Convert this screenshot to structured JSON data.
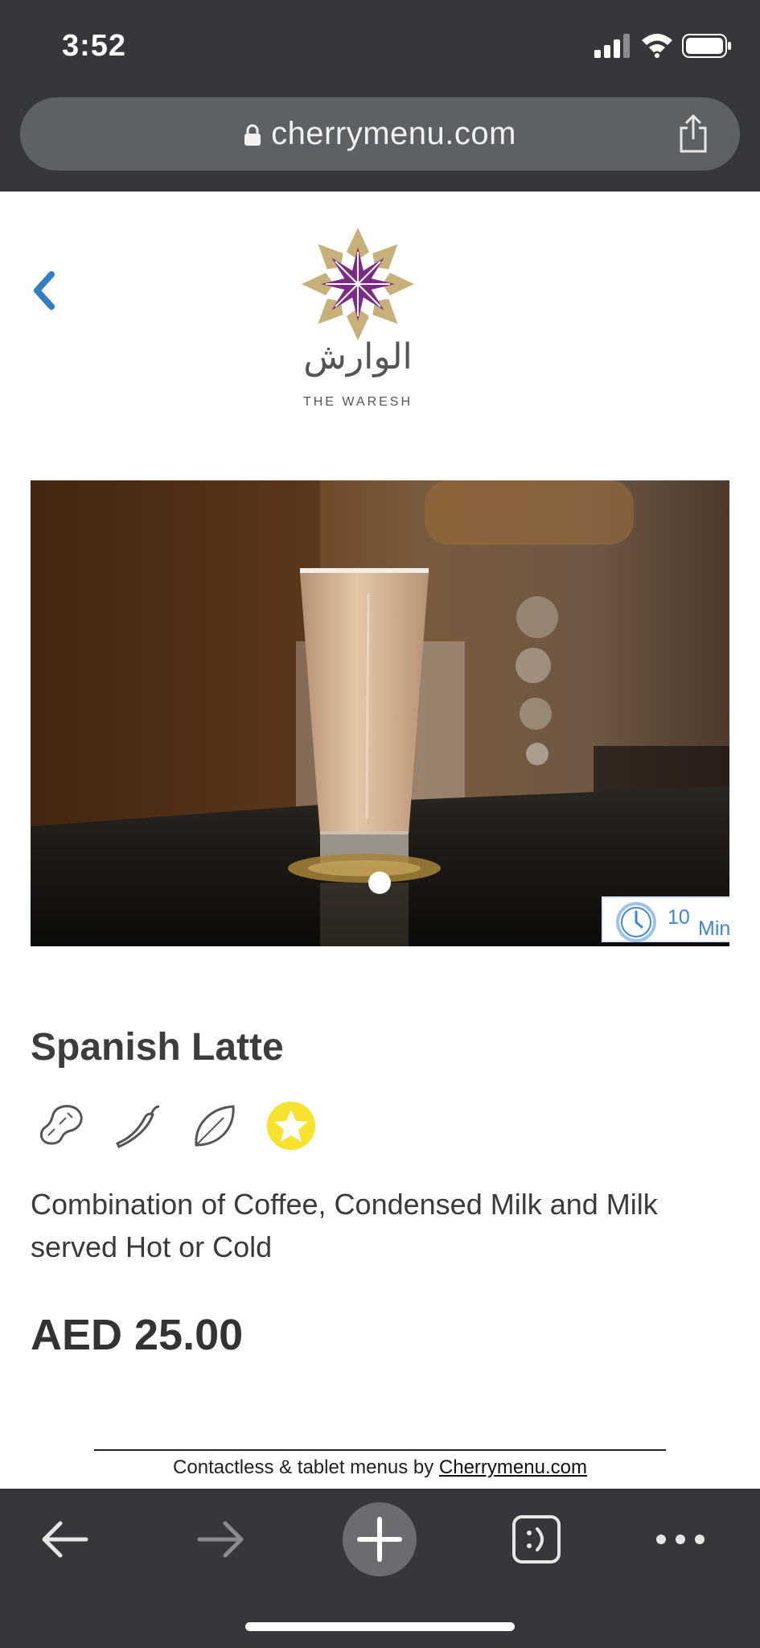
{
  "status_bar": {
    "time": "3:52"
  },
  "browser": {
    "url": "cherrymenu.com"
  },
  "header": {
    "logo_arabic": "الوارش",
    "logo_english": "THE WARESH"
  },
  "item": {
    "prep_time_value": "10",
    "prep_time_unit": "Mins",
    "title": "Spanish Latte",
    "tags": [
      "peanut-icon",
      "chili-icon",
      "leaf-icon",
      "star-badge-icon"
    ],
    "description": "Combination of Coffee, Condensed Milk and Milk served Hot or Cold",
    "price": "AED 25.00"
  },
  "footer": {
    "prefix": "Contactless & tablet menus by ",
    "link_text": "Cherrymenu.com"
  },
  "colors": {
    "chrome": "#35373a",
    "accent_blue": "#3c87d4",
    "star_yellow": "#f7e22e",
    "logo_purple": "#7b2a85",
    "logo_gold": "#c7b07a"
  }
}
